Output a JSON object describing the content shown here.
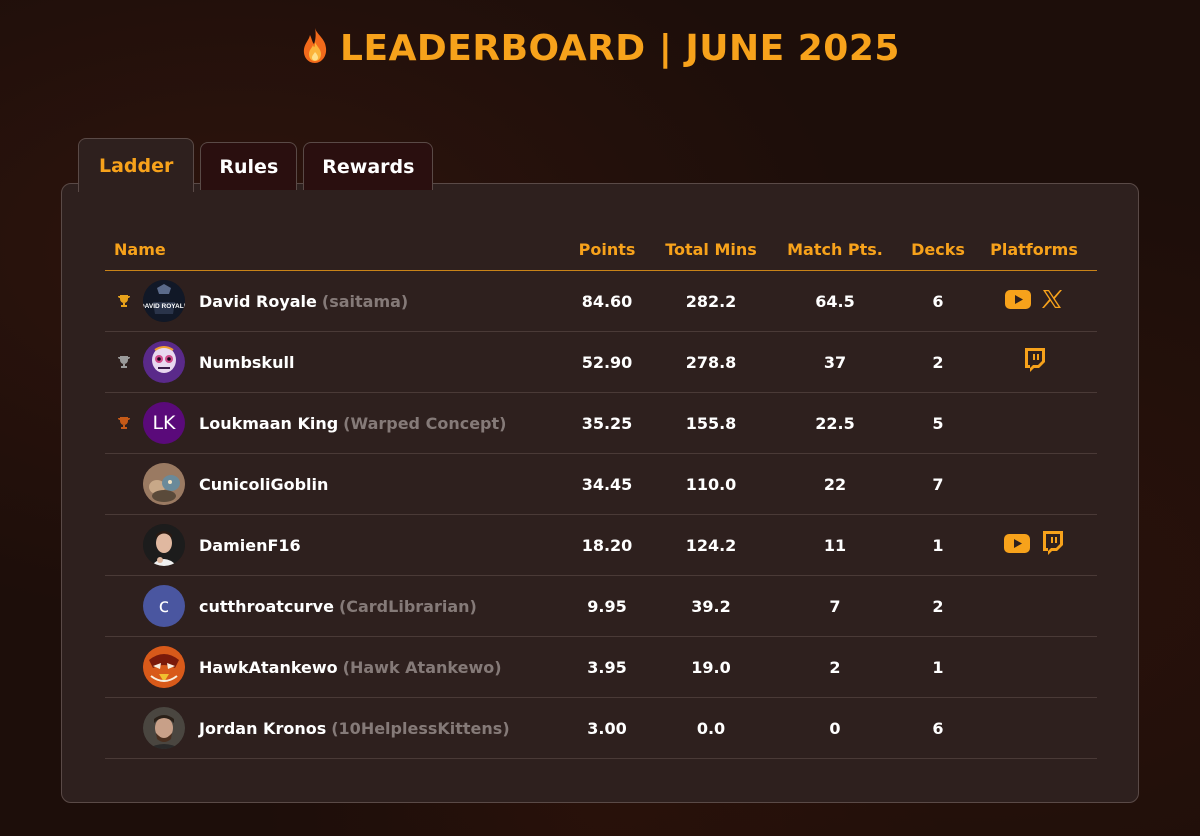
{
  "header": {
    "icon": "fire-icon",
    "title": "LEADERBOARD | JUNE 2025"
  },
  "tabs": [
    {
      "label": "Ladder",
      "active": true
    },
    {
      "label": "Rules",
      "active": false
    },
    {
      "label": "Rewards",
      "active": false
    }
  ],
  "columns": {
    "name": "Name",
    "points": "Points",
    "total_mins": "Total Mins",
    "match_pts": "Match Pts.",
    "decks": "Decks",
    "platforms": "Platforms"
  },
  "colors": {
    "accent": "#f7a21b",
    "gold": "#e8a21b",
    "silver": "#9a9a9a",
    "bronze": "#c65a18"
  },
  "rows": [
    {
      "trophy": "gold-trophy-icon",
      "avatar": "David Royale logo",
      "name": "David Royale",
      "alias": "(saitama)",
      "points": "84.60",
      "mins": "282.2",
      "match": "64.5",
      "decks": "6",
      "platforms": [
        "youtube-icon",
        "x-icon"
      ]
    },
    {
      "trophy": "silver-trophy-icon",
      "avatar": "skull art",
      "name": "Numbskull",
      "alias": "",
      "points": "52.90",
      "mins": "278.8",
      "match": "37",
      "decks": "2",
      "platforms": [
        "twitch-icon"
      ]
    },
    {
      "trophy": "bronze-trophy-icon",
      "avatar_text": "LK",
      "name": "Loukmaan King",
      "alias": "(Warped Concept)",
      "points": "35.25",
      "mins": "155.8",
      "match": "22.5",
      "decks": "5",
      "platforms": []
    },
    {
      "trophy": "",
      "avatar": "goblin art",
      "name": "CunicoliGoblin",
      "alias": "",
      "points": "34.45",
      "mins": "110.0",
      "match": "22",
      "decks": "7",
      "platforms": []
    },
    {
      "trophy": "",
      "avatar": "photo",
      "name": "DamienF16",
      "alias": "",
      "points": "18.20",
      "mins": "124.2",
      "match": "11",
      "decks": "1",
      "platforms": [
        "youtube-icon",
        "twitch-icon"
      ]
    },
    {
      "trophy": "",
      "avatar_text": "c",
      "name": "cutthroatcurve",
      "alias": "(CardLibrarian)",
      "points": "9.95",
      "mins": "39.2",
      "match": "7",
      "decks": "2",
      "platforms": []
    },
    {
      "trophy": "",
      "avatar": "hawk art",
      "name": "HawkAtankewo",
      "alias": "(Hawk Atankewo)",
      "points": "3.95",
      "mins": "19.0",
      "match": "2",
      "decks": "1",
      "platforms": []
    },
    {
      "trophy": "",
      "avatar": "photo",
      "name": "Jordan Kronos",
      "alias": "(10HelplessKittens)",
      "points": "3.00",
      "mins": "0.0",
      "match": "0",
      "decks": "6",
      "platforms": []
    }
  ]
}
